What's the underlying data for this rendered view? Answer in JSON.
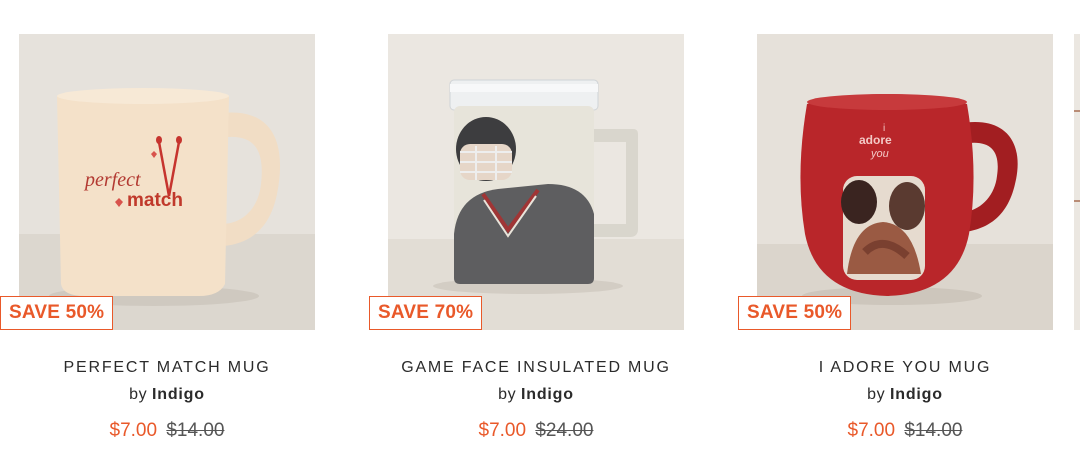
{
  "products": [
    {
      "badge": "SAVE 50%",
      "title": "PERFECT MATCH MUG",
      "by_prefix": "by",
      "brand": "Indigo",
      "sale_price": "$7.00",
      "original_price": "$14.00",
      "mug_text": [
        "perfect",
        "match"
      ]
    },
    {
      "badge": "SAVE 70%",
      "title": "GAME FACE INSULATED MUG",
      "by_prefix": "by",
      "brand": "Indigo",
      "sale_price": "$7.00",
      "original_price": "$24.00"
    },
    {
      "badge": "SAVE 50%",
      "title": "I ADORE YOU MUG",
      "by_prefix": "by",
      "brand": "Indigo",
      "sale_price": "$7.00",
      "original_price": "$14.00",
      "mug_text": [
        "i",
        "adore",
        "you"
      ]
    }
  ],
  "colors": {
    "accent": "#e9592a",
    "text": "#2b2b2b"
  }
}
